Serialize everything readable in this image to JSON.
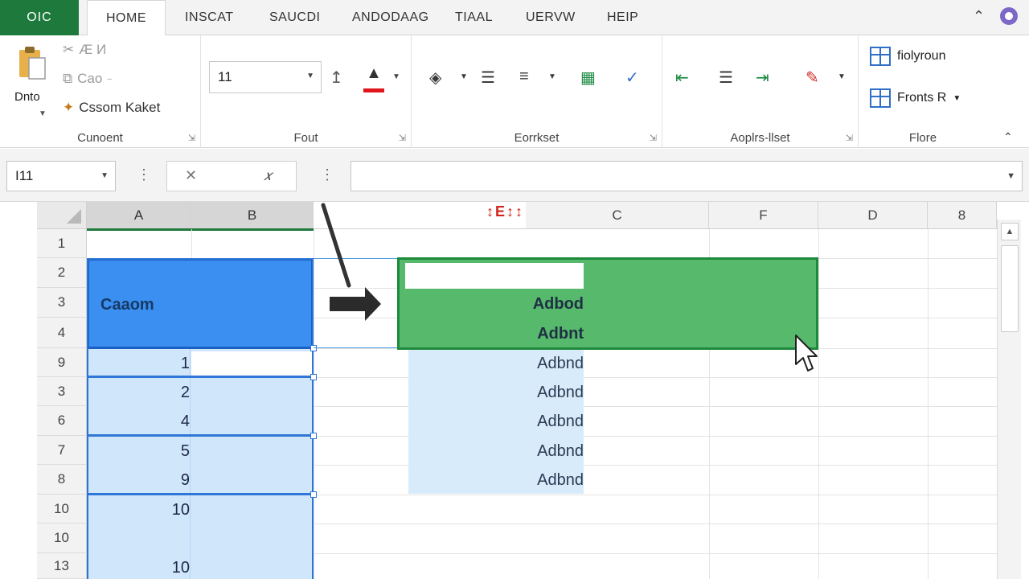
{
  "tabs": {
    "file": "OIC",
    "home": "HOME",
    "insert": "INSCAT",
    "page": "SAUCDI",
    "formulas": "ANDODAAG",
    "data": "TIAAL",
    "review": "UERVW",
    "help": "HEIP"
  },
  "ribbon": {
    "clipboard": {
      "paste_label": "Dnto",
      "cut_label": "Æ И",
      "copy_label": "Cao",
      "format_label": "Cssom Kaket",
      "group_label": "Cunoent"
    },
    "font": {
      "size_value": "11",
      "group_label": "Fout"
    },
    "alignment": {
      "group_label": "Eorrkset"
    },
    "number": {
      "group_label": "Aoplrs-llset"
    },
    "styles": {
      "item1_label": "fiolyroun",
      "item2_label": "Fronts R",
      "group_label": "Flore"
    }
  },
  "formula_bar": {
    "name_box": "I11",
    "input_value": ""
  },
  "grid": {
    "columns": [
      "A",
      "B",
      "C",
      "F",
      "D",
      "8"
    ],
    "rows": [
      "1",
      "2",
      "3",
      "4",
      "9",
      "3",
      "6",
      "7",
      "8",
      "10",
      "10",
      "13"
    ],
    "source_header": "Caaom",
    "source_values": [
      "1",
      "2",
      "4",
      "5",
      "9",
      "10",
      "10"
    ],
    "dest_values": [
      "Adbod",
      "Adbnt",
      "Adbnd",
      "Adbnd",
      "Adbnd",
      "Adbnd",
      "Adbnd"
    ],
    "move_marker": "↕E↕↕"
  },
  "colors": {
    "file_tab": "#1e7a3c",
    "source_header": "#3b8ff0",
    "source_fill": "#cfe6fb",
    "dest_fill": "#56b96c",
    "dest_border": "#1e8a3c"
  },
  "icons": [
    "paste-icon",
    "cut-icon",
    "copy-icon",
    "format-painter-icon",
    "grow-font-icon",
    "font-color-icon",
    "fill-icon",
    "align-icon",
    "wrap-icon",
    "merge-icon",
    "orientation-icon",
    "indent-icon",
    "styles-icon",
    "table-icon",
    "cursor-icon",
    "move-arrow-icon"
  ]
}
